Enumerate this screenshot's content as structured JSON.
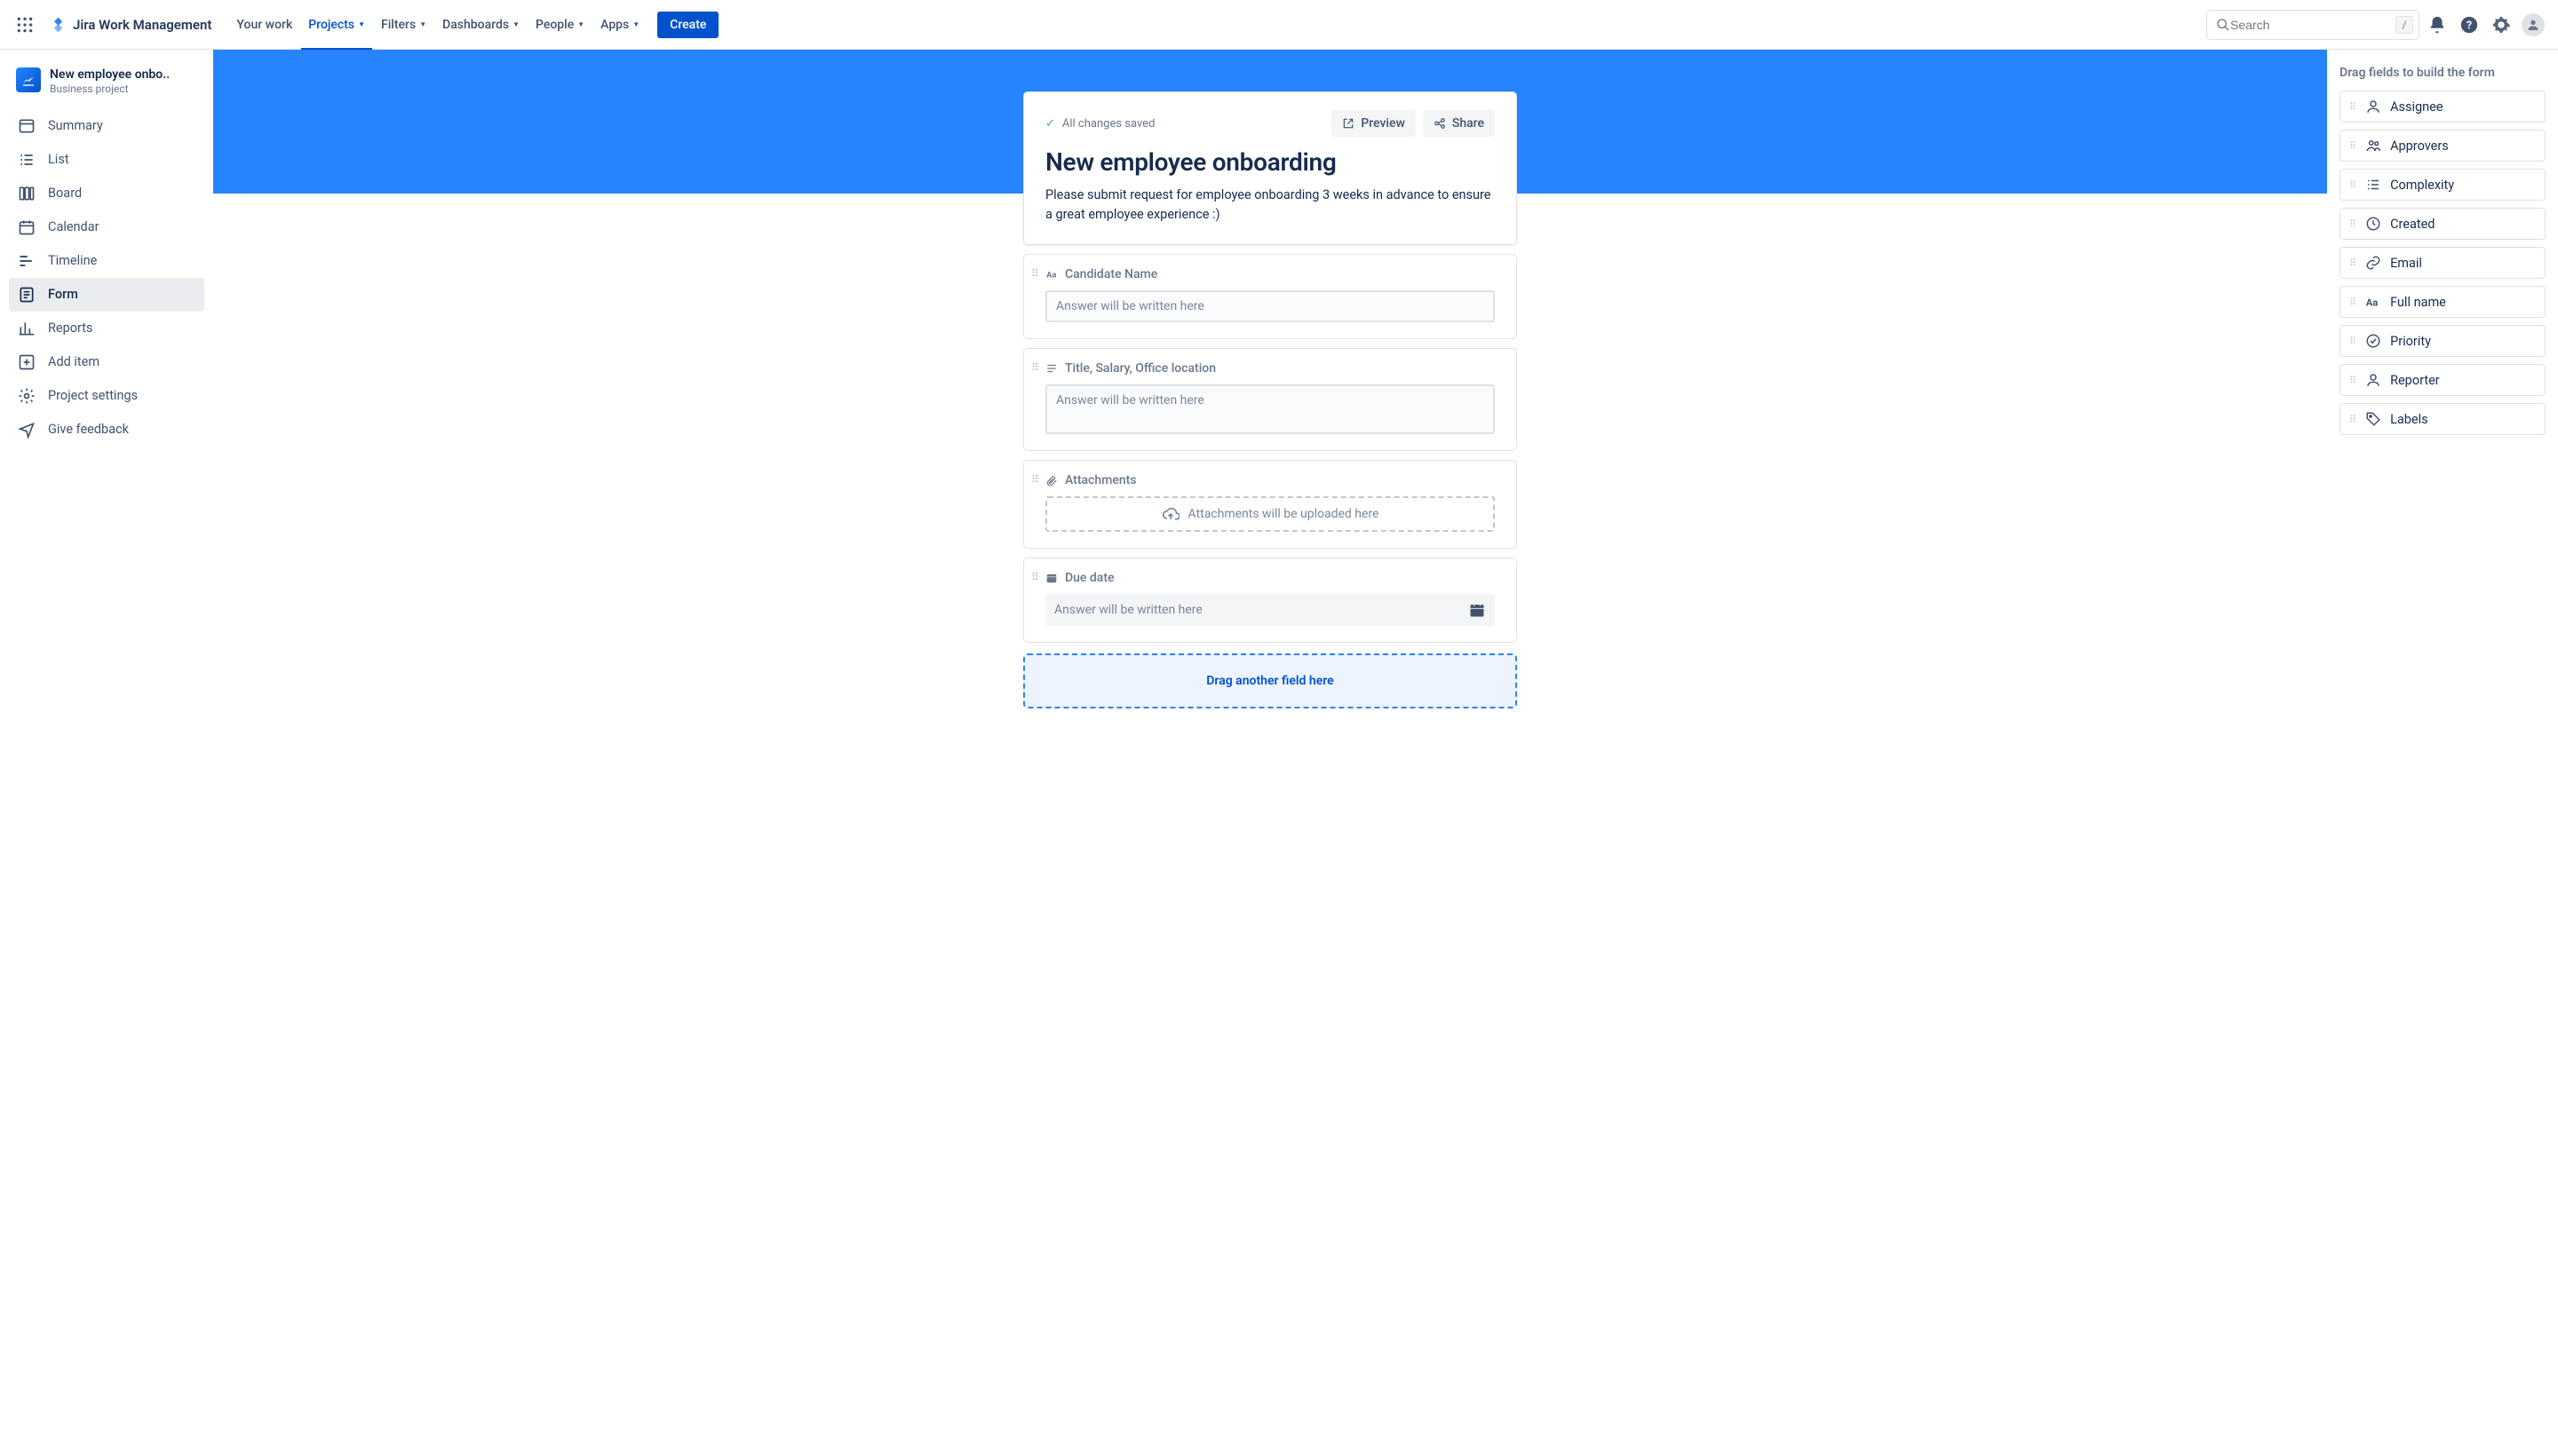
{
  "topnav": {
    "logo_text": "Jira Work Management",
    "items": [
      {
        "label": "Your work",
        "dropdown": false
      },
      {
        "label": "Projects",
        "dropdown": true,
        "active": true
      },
      {
        "label": "Filters",
        "dropdown": true
      },
      {
        "label": "Dashboards",
        "dropdown": true
      },
      {
        "label": "People",
        "dropdown": true
      },
      {
        "label": "Apps",
        "dropdown": true
      }
    ],
    "create_label": "Create",
    "search_placeholder": "Search",
    "slash_hint": "/"
  },
  "sidebar": {
    "project_title": "New employee onbo..",
    "project_subtitle": "Business project",
    "items": [
      {
        "label": "Summary",
        "icon": "summary"
      },
      {
        "label": "List",
        "icon": "list"
      },
      {
        "label": "Board",
        "icon": "board"
      },
      {
        "label": "Calendar",
        "icon": "calendar"
      },
      {
        "label": "Timeline",
        "icon": "timeline"
      },
      {
        "label": "Form",
        "icon": "form",
        "active": true
      },
      {
        "label": "Reports",
        "icon": "reports"
      },
      {
        "label": "Add item",
        "icon": "add"
      },
      {
        "label": "Project settings",
        "icon": "settings"
      },
      {
        "label": "Give feedback",
        "icon": "feedback"
      }
    ]
  },
  "form": {
    "save_status": "All changes saved",
    "preview": "Preview",
    "share": "Share",
    "title": "New employee onboarding",
    "description": "Please submit request for employee onboarding 3 weeks in advance to ensure a great employee experience :)",
    "placeholder_text": "Answer will be written here",
    "attachments_placeholder": "Attachments will be uploaded here",
    "drag_another": "Drag another field here",
    "fields": [
      {
        "label": "Candidate Name",
        "type": "text"
      },
      {
        "label": "Title, Salary, Office location",
        "type": "paragraph"
      },
      {
        "label": "Attachments",
        "type": "attachments"
      },
      {
        "label": "Due date",
        "type": "date"
      }
    ]
  },
  "rightpanel": {
    "title": "Drag fields to build the form",
    "items": [
      {
        "label": "Assignee",
        "icon": "person"
      },
      {
        "label": "Approvers",
        "icon": "people"
      },
      {
        "label": "Complexity",
        "icon": "list"
      },
      {
        "label": "Created",
        "icon": "clock"
      },
      {
        "label": "Email",
        "icon": "link"
      },
      {
        "label": "Full name",
        "icon": "text"
      },
      {
        "label": "Priority",
        "icon": "priority"
      },
      {
        "label": "Reporter",
        "icon": "person"
      },
      {
        "label": "Labels",
        "icon": "tag"
      }
    ]
  }
}
